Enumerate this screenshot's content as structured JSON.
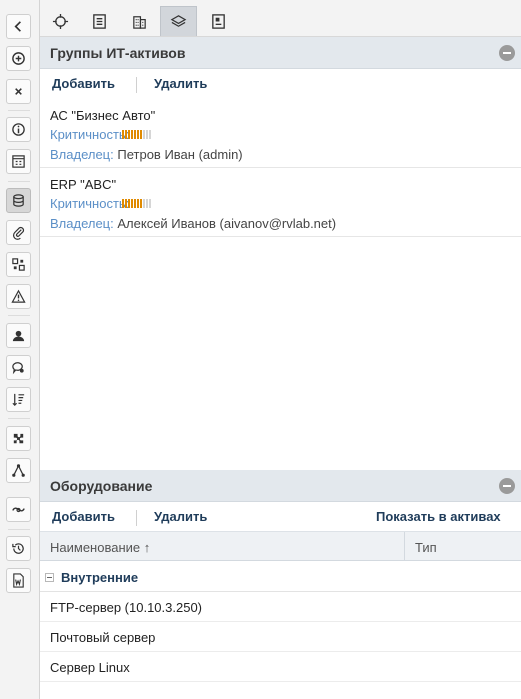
{
  "top_tabs": [
    {
      "icon": "crosshair-icon"
    },
    {
      "icon": "document-list-icon"
    },
    {
      "icon": "building-icon"
    },
    {
      "icon": "layers-icon",
      "active": true
    },
    {
      "icon": "form-icon"
    }
  ],
  "left_toolbar": [
    {
      "icon": "chevron-left-icon"
    },
    {
      "icon": "add-circle-icon"
    },
    {
      "icon": "close-icon"
    },
    {
      "icon": "info-icon"
    },
    {
      "icon": "calendar-grid-icon"
    },
    {
      "icon": "database-icon",
      "active": true
    },
    {
      "icon": "paperclip-icon"
    },
    {
      "icon": "qr-code-icon"
    },
    {
      "icon": "warning-icon"
    },
    {
      "icon": "user-icon"
    },
    {
      "icon": "comment-search-icon"
    },
    {
      "icon": "sort-icon"
    },
    {
      "icon": "puzzle-icon"
    },
    {
      "icon": "network-icon"
    },
    {
      "icon": "link-icon"
    },
    {
      "icon": "history-icon"
    },
    {
      "icon": "word-doc-icon"
    }
  ],
  "asset_groups": {
    "title": "Группы ИТ-активов",
    "add_label": "Добавить",
    "delete_label": "Удалить",
    "criticality_label": "Критичность:",
    "owner_label": "Владелец:",
    "items": [
      {
        "name": "АС \"Бизнес Авто\"",
        "owner": "Петров Иван (admin)",
        "criticality_level": 7,
        "criticality_max": 10
      },
      {
        "name": "ERP \"ABC\"",
        "owner": "Алексей Иванов (aivanov@rvlab.net)",
        "criticality_level": 7,
        "criticality_max": 10
      }
    ]
  },
  "equipment": {
    "title": "Оборудование",
    "add_label": "Добавить",
    "delete_label": "Удалить",
    "show_in_assets_label": "Показать в активах",
    "col_name": "Наименование ↑",
    "col_type": "Тип",
    "group_label": "Внутренние",
    "rows": [
      "FTP-сервер (10.10.3.250)",
      "Почтовый сервер",
      "Сервер Linux"
    ]
  },
  "colors": {
    "accent_link": "#5b8fc7",
    "action_text": "#1f3c5a",
    "criticality_on": "#f39c12",
    "header_bg": "#e3e8ed"
  }
}
